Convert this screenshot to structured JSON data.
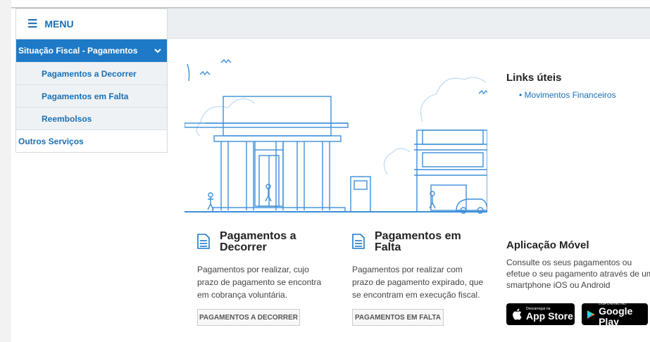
{
  "menu": {
    "title": "MENU",
    "active": "Situação Fiscal - Pagamentos",
    "items": [
      "Pagamentos a Decorrer",
      "Pagamentos em Falta",
      "Reembolsos"
    ],
    "other": "Outros Serviços"
  },
  "cards": [
    {
      "title_line1": "Pagamentos a",
      "title_line2": "Decorrer",
      "desc": "Pagamentos por realizar, cujo prazo de pagamento se encontra em cobrança voluntária.",
      "button": "PAGAMENTOS A DECORRER"
    },
    {
      "title_line1": "Pagamentos em",
      "title_line2": "Falta",
      "desc": "Pagamentos por realizar com prazo de pagamento expirado, que se encontram em execução fiscal.",
      "button": "PAGAMENTOS EM FALTA"
    }
  ],
  "links": {
    "title": "Links úteis",
    "items": [
      "Movimentos Financeiros"
    ]
  },
  "app": {
    "title": "Aplicação Móvel",
    "desc": "Consulte os seus pagamentos ou efetue o seu pagamento através de um smartphone iOS ou Android",
    "appstore_small": "Descarregar na",
    "appstore_big": "App Store",
    "play_small": "DISPONÍVEL NO",
    "play_big": "Google Play"
  },
  "colors": {
    "accent": "#1e7ac6",
    "link": "#1a6fb4"
  }
}
